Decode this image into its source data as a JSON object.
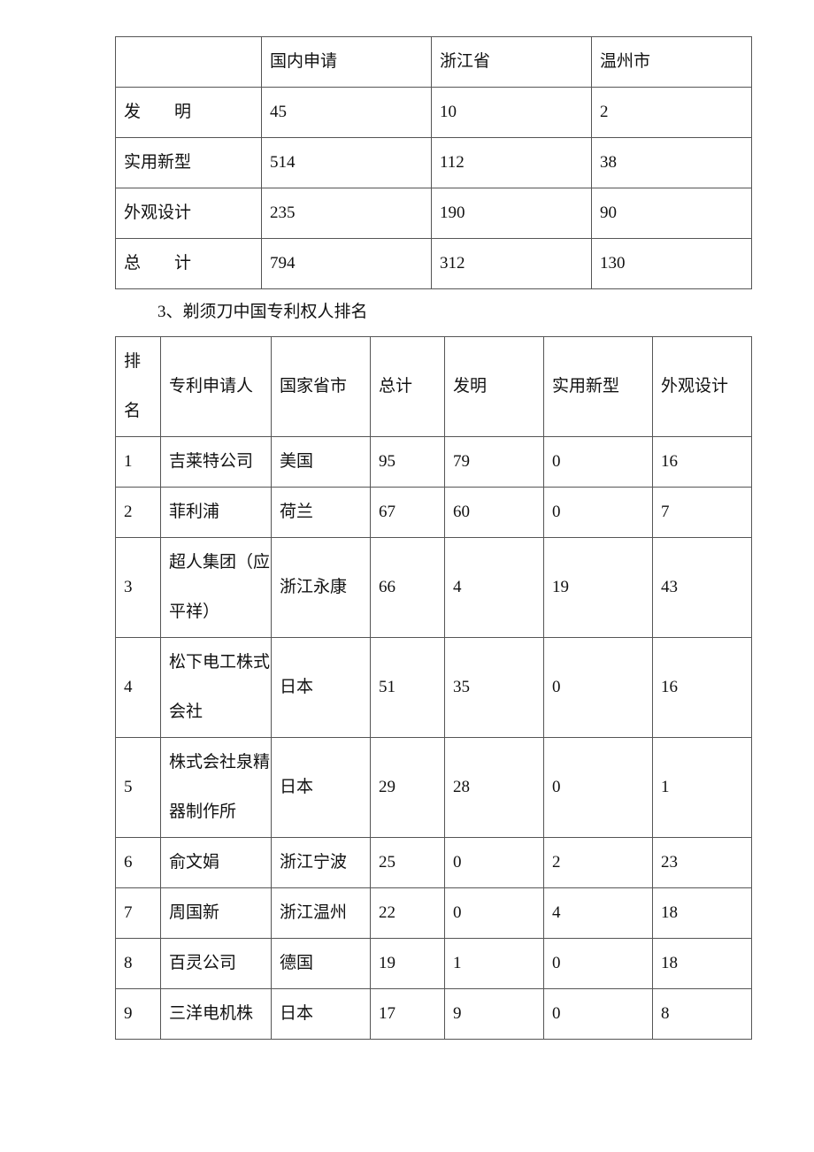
{
  "table1": {
    "headers": [
      "",
      "国内申请",
      "浙江省",
      "温州市"
    ],
    "rows": [
      {
        "label": "发　　明",
        "values": [
          "45",
          "10",
          "2"
        ]
      },
      {
        "label": "实用新型",
        "values": [
          "514",
          "112",
          "38"
        ]
      },
      {
        "label": "外观设计",
        "values": [
          "235",
          "190",
          "90"
        ]
      },
      {
        "label": "总　　计",
        "values": [
          "794",
          "312",
          "130"
        ]
      }
    ]
  },
  "section_title": "3、剃须刀中国专利权人排名",
  "table2": {
    "headers": [
      "排名",
      "专利申请人",
      "国家省市",
      "总计",
      "发明",
      "实用新型",
      "外观设计"
    ],
    "header_rank_lines": [
      "排",
      "名"
    ],
    "rows": [
      {
        "rank": "1",
        "applicant": "吉莱特公司",
        "region": "美国",
        "total": "95",
        "invention": "79",
        "utility": "0",
        "design": "16"
      },
      {
        "rank": "2",
        "applicant": "菲利浦",
        "region": "荷兰",
        "total": "67",
        "invention": "60",
        "utility": "0",
        "design": "7"
      },
      {
        "rank": "3",
        "applicant": "超人集团（应平祥）",
        "region": "浙江永康",
        "total": "66",
        "invention": "4",
        "utility": "19",
        "design": "43"
      },
      {
        "rank": "4",
        "applicant": "松下电工株式会社",
        "region": "日本",
        "total": "51",
        "invention": "35",
        "utility": "0",
        "design": "16"
      },
      {
        "rank": "5",
        "applicant": "株式会社泉精器制作所",
        "region": "日本",
        "total": "29",
        "invention": "28",
        "utility": "0",
        "design": "1"
      },
      {
        "rank": "6",
        "applicant": "俞文娟",
        "region": "浙江宁波",
        "total": "25",
        "invention": "0",
        "utility": "2",
        "design": "23"
      },
      {
        "rank": "7",
        "applicant": "周国新",
        "region": "浙江温州",
        "total": "22",
        "invention": "0",
        "utility": "4",
        "design": "18"
      },
      {
        "rank": "8",
        "applicant": "百灵公司",
        "region": "德国",
        "total": "19",
        "invention": "1",
        "utility": "0",
        "design": "18"
      },
      {
        "rank": "9",
        "applicant": "三洋电机株",
        "region": "日本",
        "total": "17",
        "invention": "9",
        "utility": "0",
        "design": "8"
      }
    ]
  }
}
